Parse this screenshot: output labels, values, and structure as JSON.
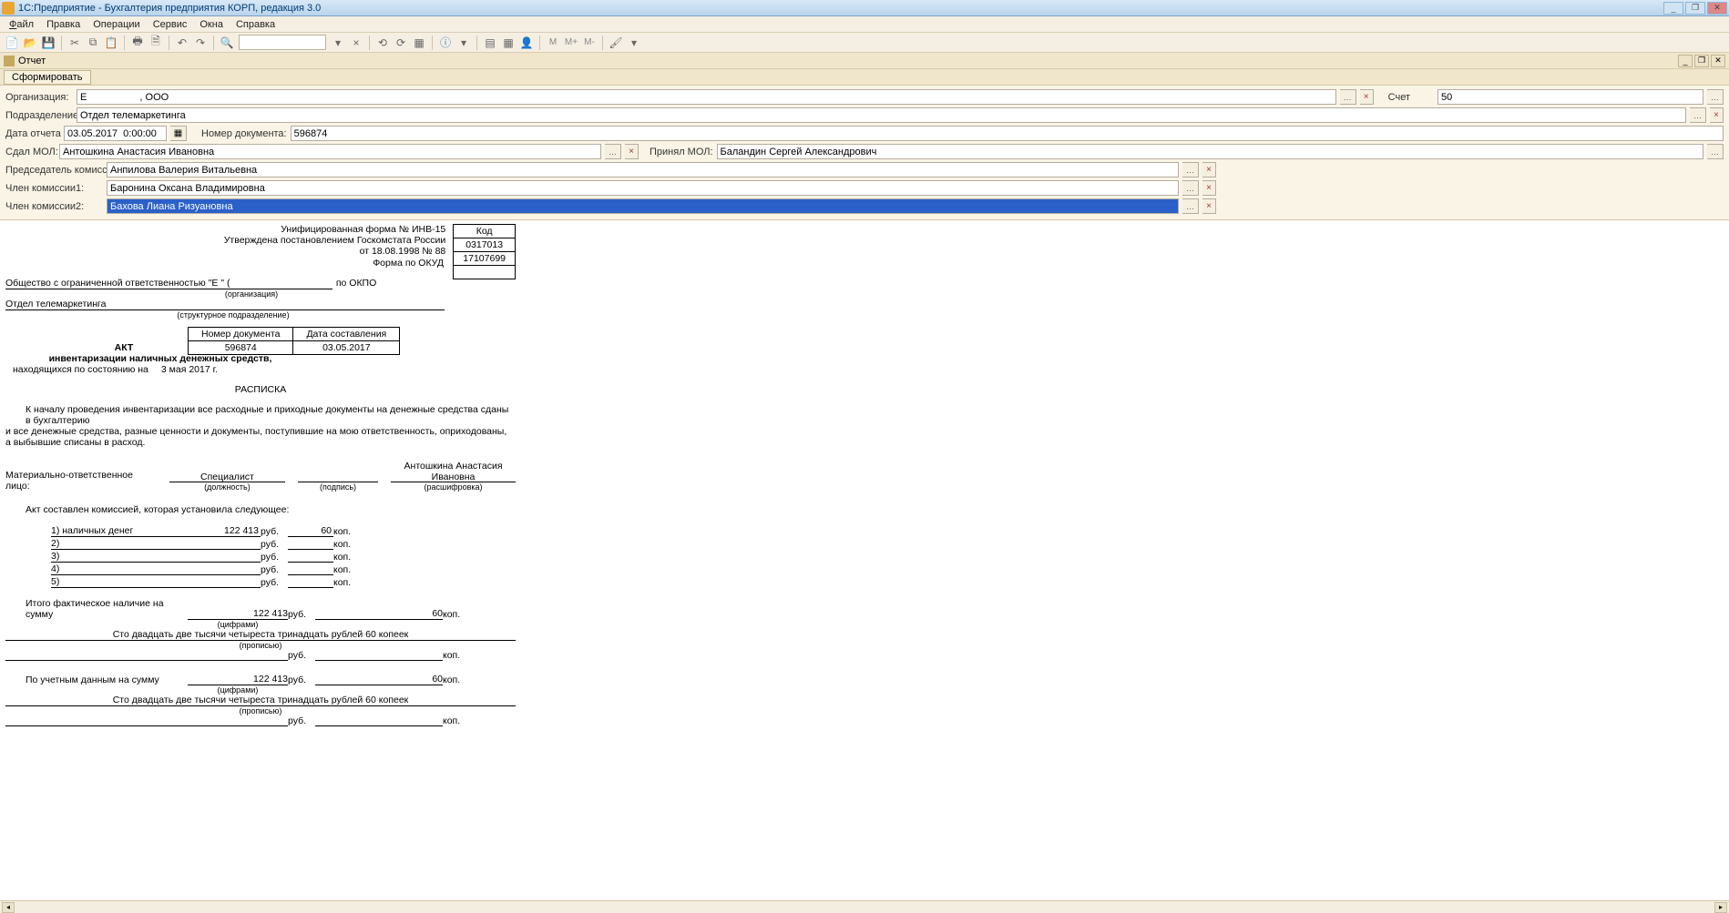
{
  "window": {
    "title": "1С:Предприятие - Бухгалтерия предприятия КОРП, редакция 3.0"
  },
  "menu": {
    "file": "Файл",
    "edit": "Правка",
    "operations": "Операции",
    "service": "Сервис",
    "windows": "Окна",
    "help": "Справка"
  },
  "subheader": {
    "title": "Отчет"
  },
  "formbar": {
    "submit": "Сформировать"
  },
  "params": {
    "org_label": "Организация:",
    "org_value": "Е                   , ООО",
    "dept_label": "Подразделение:",
    "dept_value": "Отдел телемаркетинга",
    "date_label": "Дата отчета",
    "date_value": "03.05.2017  0:00:00",
    "docnum_label": "Номер документа:",
    "docnum_value": "596874",
    "handed_label": "Сдал МОЛ:",
    "handed_value": "Антошкина Анастасия Ивановна",
    "accepted_label": "Принял МОЛ:",
    "accepted_value": "Баландин Сергей Александрович",
    "chairman_label": "Председатель комиссии:",
    "chairman_value": "Анпилова Валерия Витальевна",
    "member1_label": "Член комиссии1:",
    "member1_value": "Баронина Оксана Владимировна",
    "member2_label": "Член комиссии2:",
    "member2_value": "Бахова Лиана Ризуановна",
    "account_label": "Счет",
    "account_value": "50"
  },
  "report": {
    "form_title": "Унифицированная форма № ИНВ-15",
    "approved": "Утверждена постановлением Госкомстата России",
    "approved_date": "от 18.08.1998 № 88",
    "code_hdr": "Код",
    "okud_label": "Форма по ОКУД",
    "okud": "0317013",
    "okpo_label": "по ОКПО",
    "okpo": "17107699",
    "org_full": "Общество с ограниченной ответственностью \"Е               \" (",
    "org_caption": "(организация)",
    "dept_full": "Отдел телемаркетинга",
    "dept_caption": "(структурное подразделение)",
    "docnum_hdr": "Номер документа",
    "docdate_hdr": "Дата составления",
    "docnum": "596874",
    "docdate": "03.05.2017",
    "act": "АКТ",
    "act_sub": "инвентаризации наличных денежных средств,",
    "act_asof": "находящихся по состоянию на",
    "act_asof_date": "3 мая 2017 г.",
    "receipt": "РАСПИСКА",
    "receipt_text1": "К началу проведения инвентаризации все расходные и приходные документы на денежные средства сданы в бухгалтерию",
    "receipt_text2": "и все денежные средства, разные ценности и документы, поступившие на мою ответственность, оприходованы,",
    "receipt_text3": "а выбывшие списаны в расход.",
    "mol_label": "Материально-ответственное лицо:",
    "mol_pos": "Специалист",
    "mol_pos_cap": "(должность)",
    "mol_sign_cap": "(подпись)",
    "mol_name": "Антошкина Анастасия Ивановна",
    "mol_name_cap": "(расшифровка)",
    "commission_text": "Акт составлен комиссией, которая установила следующее:",
    "row1": "1) наличных денег",
    "row2": "2)",
    "row3": "3)",
    "row4": "4)",
    "row5": "5)",
    "rub": "руб.",
    "kop": "коп.",
    "amount_rub": "122 413",
    "amount_kop": "60",
    "total_label": "Итого фактическое наличие на сумму",
    "total_cap": "(цифрами)",
    "words": "Сто двадцать две тысячи четыреста тринадцать рублей 60 копеек",
    "words_cap": "(прописью)",
    "book_label": "По учетным данным на сумму"
  }
}
